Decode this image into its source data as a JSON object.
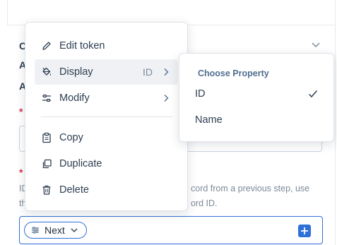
{
  "form": {
    "collapsed_labels": [
      "C",
      "A",
      "A"
    ],
    "required_marker": "*",
    "help_line1_start": "ID",
    "help_line1_end": "cord from a previous step, use",
    "help_line2_start": "th",
    "help_line2_end": "ord ID.",
    "token": {
      "label": "Next",
      "icon": "token-sliders-icon"
    },
    "add_icon": "plus-square-icon"
  },
  "menu": {
    "items": [
      {
        "label": "Edit token",
        "icon": "pencil-icon"
      },
      {
        "label": "Display",
        "icon": "paint-bucket-icon",
        "value": "ID",
        "has_submenu": true
      },
      {
        "label": "Modify",
        "icon": "sliders-icon",
        "has_submenu": true
      },
      {
        "label": "Copy",
        "icon": "clipboard-icon"
      },
      {
        "label": "Duplicate",
        "icon": "duplicate-icon"
      },
      {
        "label": "Delete",
        "icon": "trash-icon"
      }
    ]
  },
  "submenu": {
    "header": "Choose Property",
    "options": [
      {
        "label": "ID",
        "selected": true
      },
      {
        "label": "Name",
        "selected": false
      }
    ]
  },
  "colors": {
    "accent": "#2f6fd8",
    "text": "#2d3e50",
    "muted": "#7c8a99",
    "required": "#d9344f",
    "hover": "#eff1f4"
  }
}
